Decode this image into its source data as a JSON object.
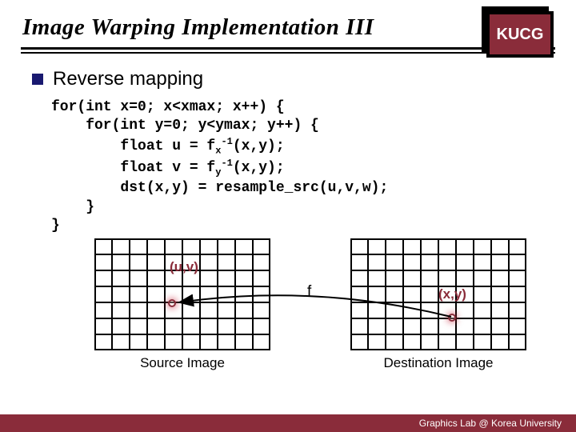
{
  "header": {
    "title": "Image Warping Implementation III",
    "badge": "KUCG"
  },
  "section": {
    "heading": "Reverse mapping"
  },
  "code": {
    "l1": "for(int x=0; x<xmax; x++) {",
    "l2": "    for(int y=0; y<ymax; y++) {",
    "l3a": "        float u = f",
    "l3_sub": "x",
    "l3_sup": "-1",
    "l3b": "(x,y);",
    "l4a": "        float v = f",
    "l4_sub": "y",
    "l4_sup": "-1",
    "l4b": "(x,y);",
    "l5": "        dst(x,y) = resample_src(u,v,w);",
    "l6": "    }",
    "l7": "}"
  },
  "figure": {
    "uv": "(u,v)",
    "xy": "(x,y)",
    "f": "f",
    "source_label": "Source Image",
    "dest_label": "Destination Image"
  },
  "footer": {
    "text": "Graphics Lab @ Korea University"
  }
}
